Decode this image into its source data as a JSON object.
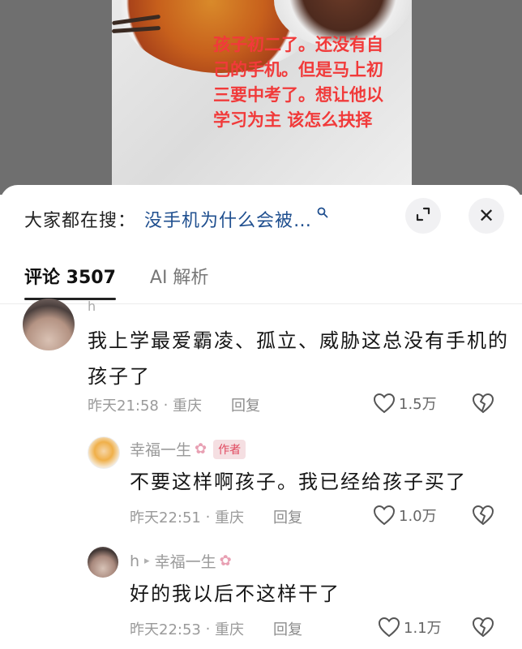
{
  "video": {
    "overlay_text": "孩子初二了。还没有自己的手机。但是马上初三要中考了。想让他以学习为主 该怎么抉择"
  },
  "search": {
    "label": "大家都在搜：",
    "query": "没手机为什么会被…",
    "icon": "search-icon"
  },
  "buttons": {
    "expand_icon": "expand-icon",
    "close_icon": "close-icon",
    "close_glyph": "✕"
  },
  "tabs": [
    {
      "label": "评论 3507",
      "active": true
    },
    {
      "label": "AI 解析",
      "active": false
    }
  ],
  "comments": [
    {
      "username": "h",
      "text": "我上学最爱霸凌、孤立、威胁这总没有手机的孩子了",
      "time": "昨天21:58",
      "location": "重庆",
      "reply_label": "回复",
      "likes": "1.5万"
    },
    {
      "username": "幸福一生",
      "badge": "作者",
      "text": "不要这样啊孩子。我已经给孩子买了",
      "time": "昨天22:51",
      "location": "重庆",
      "reply_label": "回复",
      "likes": "1.0万"
    },
    {
      "username": "h",
      "reply_to": "幸福一生",
      "text": "好的我以后不这样干了",
      "time": "昨天22:53",
      "location": "重庆",
      "reply_label": "回复",
      "likes": "1.1万"
    }
  ],
  "colors": {
    "overlay_red": "#f13a3a",
    "search_blue": "#1f4f8f",
    "author_badge": "#e0485f"
  }
}
